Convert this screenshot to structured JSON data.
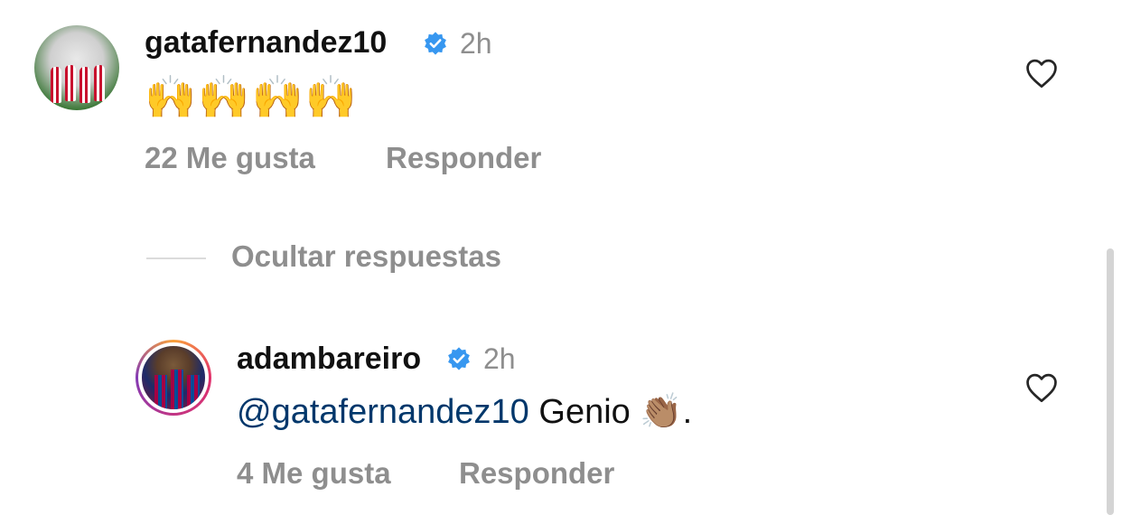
{
  "comments": [
    {
      "username": "gatafernandez10",
      "time": "2h",
      "text": "🙌🙌🙌🙌",
      "likes": "22 Me gusta",
      "reply": "Responder"
    }
  ],
  "hide_replies": "Ocultar respuestas",
  "replies": [
    {
      "username": "adambareiro",
      "time": "2h",
      "mention": "@gatafernandez10",
      "text": "Genio 👏🏽.",
      "likes": "4 Me gusta",
      "reply": "Responder"
    }
  ],
  "icons": {
    "verified": "verified-badge-icon",
    "like": "heart-icon"
  },
  "colors": {
    "verified": "#3797f0",
    "mention": "#00376b",
    "secondary_text": "#8e8e8e"
  }
}
